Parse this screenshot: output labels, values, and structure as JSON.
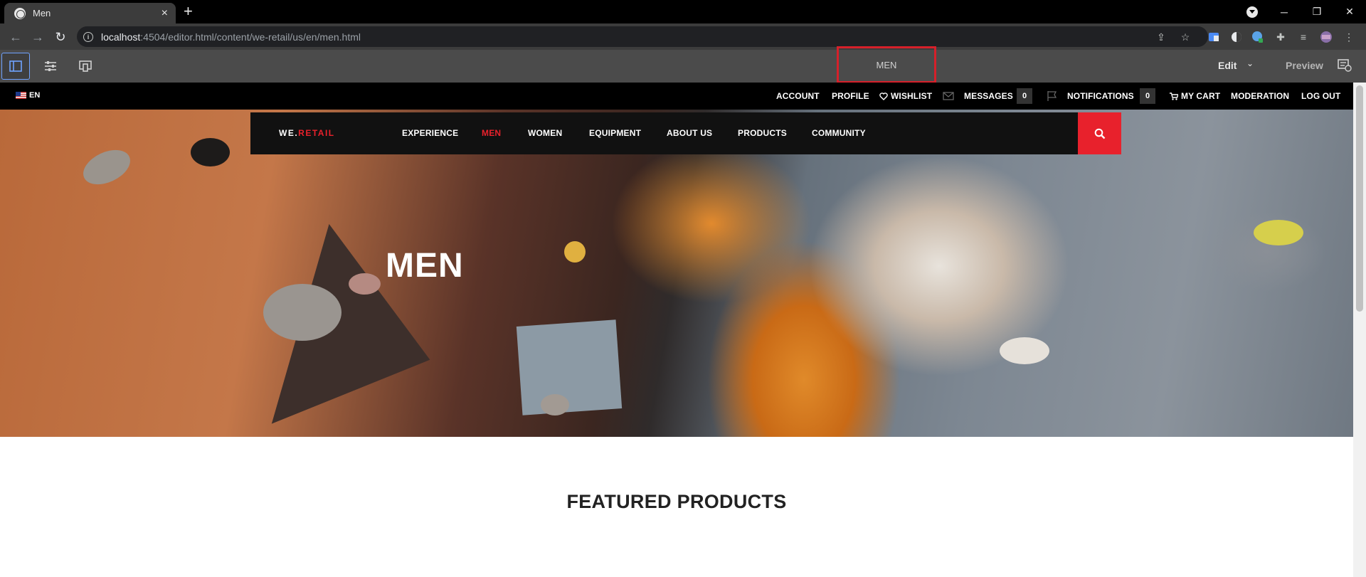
{
  "browser": {
    "tab_title": "Men",
    "new_tab_symbol": "+",
    "tab_close_symbol": "×",
    "url_host": "localhost",
    "url_path": ":4504/editor.html/content/we-retail/us/en/men.html",
    "window_controls": [
      "─",
      "❐",
      "✕"
    ]
  },
  "editor": {
    "page_title": "MEN",
    "mode_label": "Edit",
    "preview_label": "Preview"
  },
  "site": {
    "language": "EN",
    "util_links": {
      "account": "ACCOUNT",
      "profile": "PROFILE",
      "wishlist": "WISHLIST",
      "messages": "MESSAGES",
      "messages_count": "0",
      "notifications": "NOTIFICATIONS",
      "notifications_count": "0",
      "cart": "MY CART",
      "moderation": "MODERATION",
      "logout": "LOG OUT"
    },
    "brand": {
      "we": "WE.",
      "retail": "RETAIL"
    },
    "nav": {
      "experience": "EXPERIENCE",
      "men": "MEN",
      "women": "WOMEN",
      "equipment": "EQUIPMENT",
      "about": "ABOUT US",
      "products": "PRODUCTS",
      "community": "COMMUNITY"
    },
    "hero_title": "MEN",
    "featured_title": "FEATURED PRODUCTS"
  },
  "colors": {
    "brand_red": "#e8212c",
    "highlight_red": "#d6202a",
    "editor_bar": "#4b4b4b"
  }
}
